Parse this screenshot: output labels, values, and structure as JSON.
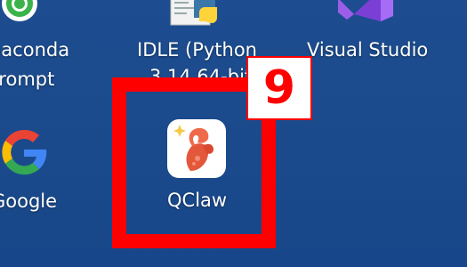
{
  "desktop": {
    "icons": [
      {
        "name": "anaconda",
        "label_line1": "naconda",
        "label_line2": "Prompt",
        "icon": "anaconda-icon"
      },
      {
        "name": "idle",
        "label_line1": "IDLE (Python",
        "label_line2": "3.14 64-bit)",
        "icon": "python-idle-icon"
      },
      {
        "name": "visual-studio",
        "label": "Visual Studio",
        "icon": "visual-studio-icon"
      },
      {
        "name": "google",
        "label": "Google",
        "icon": "google-icon"
      },
      {
        "name": "qclaw",
        "label": "QClaw",
        "icon": "qclaw-lobster-icon"
      }
    ]
  },
  "highlight": {
    "badge_number": "9",
    "color": "#ff0000"
  },
  "colors": {
    "desktop_background": "#1c4c8f",
    "label_text": "#ffffff"
  }
}
